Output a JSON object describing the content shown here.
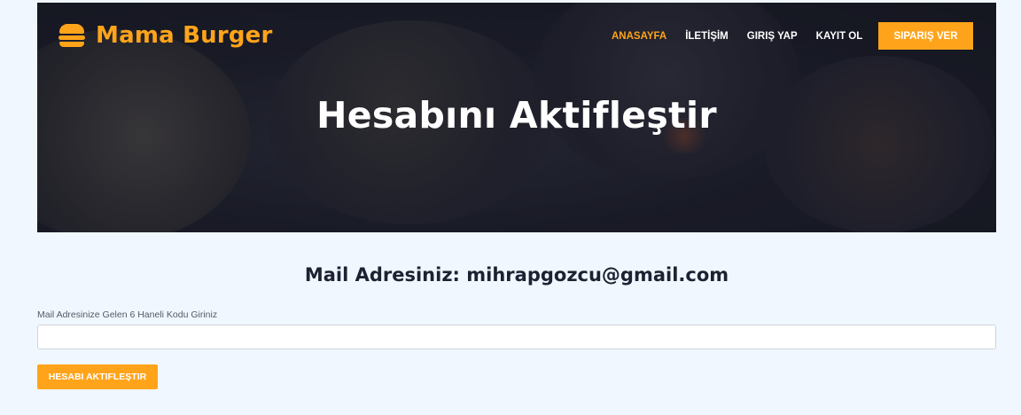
{
  "brand": {
    "name": "Mama Burger",
    "icon": "burger-icon",
    "color": "#ffa41a"
  },
  "nav": {
    "links": [
      {
        "label": "ANASAYFA",
        "active": true
      },
      {
        "label": "İLETİŞİM",
        "active": false
      },
      {
        "label": "GIRIŞ YAP",
        "active": false
      },
      {
        "label": "KAYIT OL",
        "active": false
      }
    ],
    "order_button": "SIPARIŞ VER"
  },
  "hero": {
    "title": "Hesabını Aktifleştir"
  },
  "form": {
    "mail_heading": "Mail Adresiniz: mihrapgozcu@gmail.com",
    "code_label": "Mail Adresinize Gelen 6 Haneli Kodu Giriniz",
    "code_value": "",
    "code_placeholder": "",
    "submit_label": "HESABI AKTIFLEŞTIR"
  },
  "colors": {
    "accent": "#ffa41a",
    "page_background": "#f1f7fe",
    "heading": "#1d2233"
  }
}
